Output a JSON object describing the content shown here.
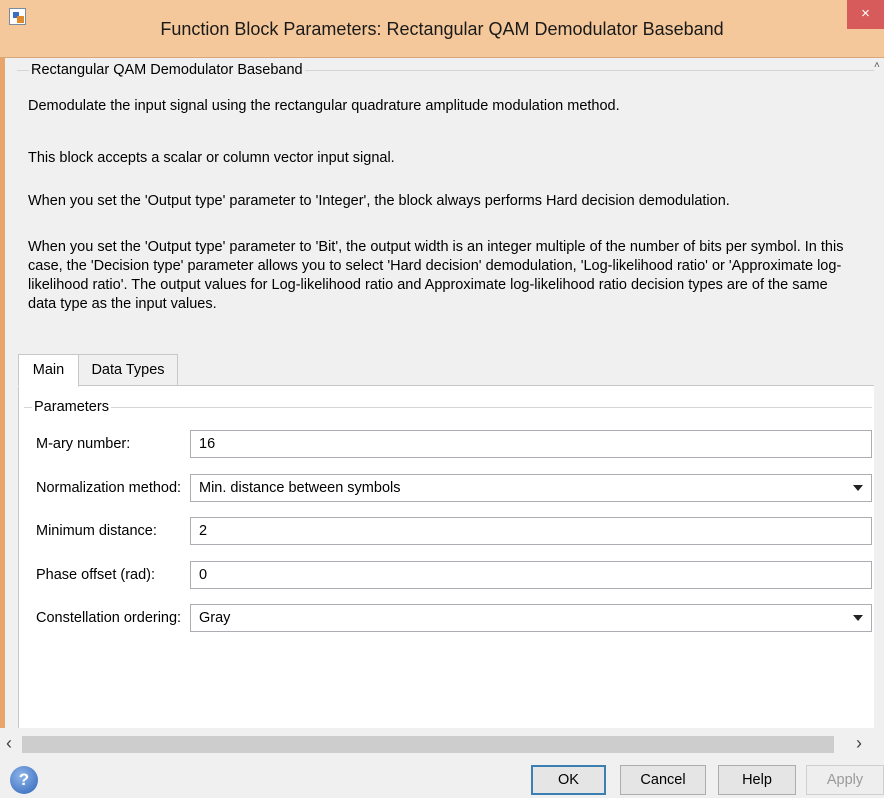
{
  "window": {
    "title": "Function Block Parameters: Rectangular QAM Demodulator Baseband",
    "close_label": "×"
  },
  "description": {
    "group_title": "Rectangular QAM Demodulator Baseband",
    "para1": "Demodulate the input signal using the rectangular quadrature amplitude modulation method.",
    "para2": "This block accepts a scalar or column vector input signal.",
    "para3": "When you set the 'Output type' parameter to 'Integer', the block always performs Hard decision demodulation.",
    "para4_line1": "When you set the 'Output type' parameter to 'Bit', the output width is an integer multiple of the number of bits per symbol. In this",
    "para4_line2": "case, the 'Decision type' parameter allows you to select 'Hard decision' demodulation, 'Log-likelihood ratio' or 'Approximate log-",
    "para4_line3": "likelihood ratio'. The output values for Log-likelihood ratio and Approximate log-likelihood ratio decision types are of the same",
    "para4_line4": "data type as the input values."
  },
  "tabs": [
    {
      "label": "Main",
      "active": true
    },
    {
      "label": "Data Types",
      "active": false
    }
  ],
  "parameters": {
    "group_title": "Parameters",
    "m_ary": {
      "label": "M-ary number:",
      "value": "16"
    },
    "normalization": {
      "label": "Normalization method:",
      "value": "Min. distance between symbols"
    },
    "min_distance": {
      "label": "Minimum distance:",
      "value": "2"
    },
    "phase_offset": {
      "label": "Phase offset (rad):",
      "value": "0"
    },
    "constellation": {
      "label": "Constellation ordering:",
      "value": "Gray"
    }
  },
  "buttons": {
    "ok": "OK",
    "cancel": "Cancel",
    "help": "Help",
    "apply": "Apply"
  },
  "icons": {
    "help": "help-icon",
    "scroll_left": "‹",
    "scroll_right": "›",
    "scroll_up": "˄",
    "scroll_down": "˅"
  },
  "colors": {
    "titlebar": "#f4c89a",
    "close": "#d75b5b",
    "accent_border": "#3c7fb1"
  }
}
